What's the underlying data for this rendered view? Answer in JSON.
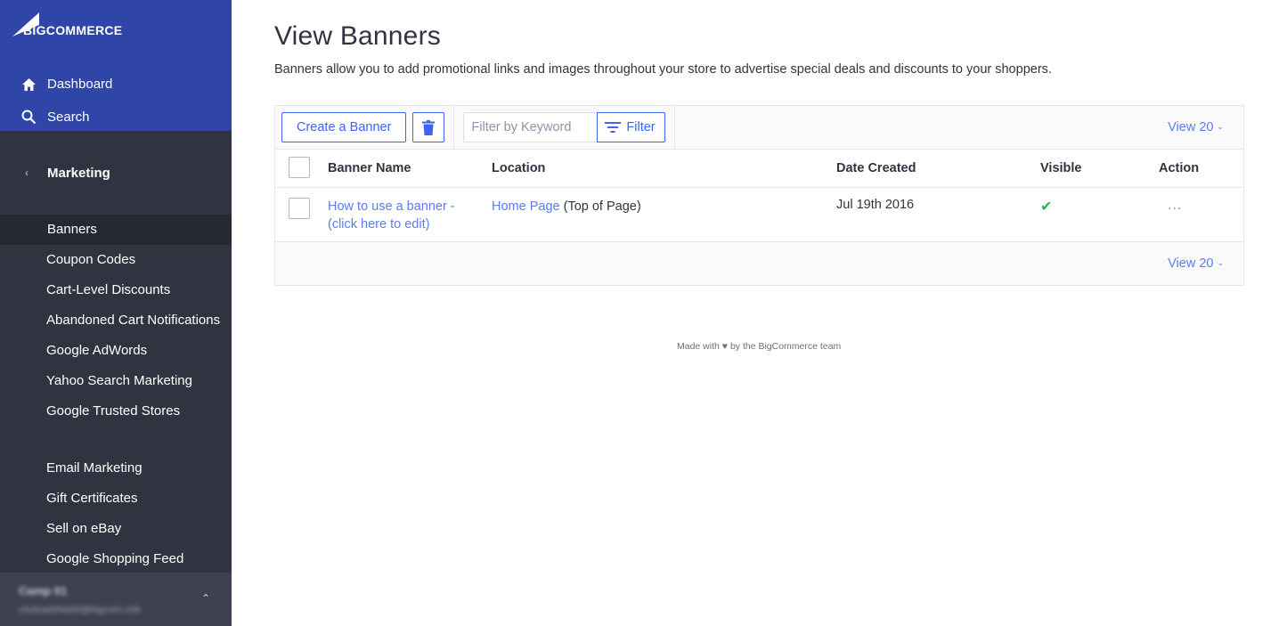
{
  "sidebar": {
    "logo_text": "BIGCOMMERCE",
    "top_nav": [
      {
        "label": "Dashboard",
        "icon": "home-icon"
      },
      {
        "label": "Search",
        "icon": "search-icon"
      }
    ],
    "section": {
      "label": "Marketing",
      "icon": "chevron-left-icon"
    },
    "items_group1": [
      {
        "label": "Banners",
        "active": true
      },
      {
        "label": "Coupon Codes"
      },
      {
        "label": "Cart-Level Discounts"
      },
      {
        "label": "Abandoned Cart Notifications"
      },
      {
        "label": "Google AdWords"
      },
      {
        "label": "Yahoo Search Marketing"
      },
      {
        "label": "Google Trusted Stores"
      }
    ],
    "items_group2": [
      {
        "label": "Email Marketing"
      },
      {
        "label": "Gift Certificates"
      },
      {
        "label": "Sell on eBay"
      },
      {
        "label": "Google Shopping Feed"
      }
    ],
    "account": {
      "name": "Camp 01",
      "email": "ctsdsadsfstsfd@bigcom.info"
    }
  },
  "main": {
    "title": "View Banners",
    "description": "Banners allow you to add promotional links and images throughout your store to advertise special deals and discounts to your shoppers.",
    "toolbar": {
      "create_label": "Create a Banner",
      "filter_placeholder": "Filter by Keyword",
      "filter_label": "Filter",
      "view_label": "View 20"
    },
    "table": {
      "headers": [
        "Banner Name",
        "Location",
        "Date Created",
        "Visible",
        "Action"
      ],
      "rows": [
        {
          "name": "How to use a banner - (click here to edit)",
          "location_link": "Home Page",
          "location_suffix": "(Top of Page)",
          "date": "Jul 19th 2016",
          "visible": true,
          "action": "..."
        }
      ]
    },
    "footer_view_label": "View 20"
  },
  "footer": {
    "made_with_prefix": "Made with",
    "made_with_suffix": "by the BigCommerce team"
  },
  "colors": {
    "sidebar_top": "#3045a8",
    "sidebar": "#313440",
    "accent": "#3c64f4",
    "link": "#5b7cf2",
    "success": "#2bb24c"
  }
}
